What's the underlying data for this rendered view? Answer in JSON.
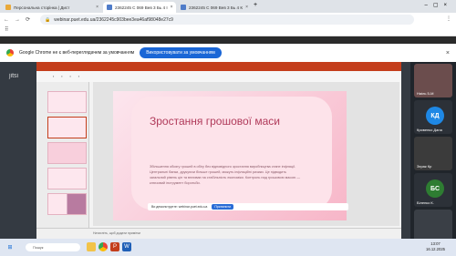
{
  "tabs": [
    {
      "label": "Персональна сторінка | Дист"
    },
    {
      "label": "2362245 С 069 Вев 3 Бь 4 І"
    },
    {
      "label": "2362245 С 069 Вев 3 Бь 4 К"
    }
  ],
  "address": {
    "url": "webinar.puet.edu.ua/2362245c903bee3ea46af98048e27c9"
  },
  "notice": {
    "text": "Google Chrome не є веб-переглядачем за умовчанням",
    "button": "Використовувати за умовчанням"
  },
  "jitsi": {
    "logo": "jitsi"
  },
  "slide": {
    "title": "Зростання грошової маси",
    "body": "Збільшення обсягу грошей в обігу без відповідного зростання виробництва стане інфляції. Центральні банки, друкуючи більше грошей, можуть інфляційні ризики. Це підводить загальний рівень цін та впливає на стабільність економіки. Контроль над грошовою масою — ключовий інструмент боротьби."
  },
  "status": {
    "text": "Натисніть, щоб додати примітки"
  },
  "share": {
    "text": "Ви демонструєте: webinar.puet.edu.ua",
    "stop": "Припинити"
  },
  "participants": [
    {
      "initials": "",
      "name": "Наіль 5-М",
      "color": "#7f5b5b"
    },
    {
      "initials": "КД",
      "name": "Кривенко Дана",
      "color": "#1e88e5"
    },
    {
      "initials": "",
      "name": "Зєрак Кр",
      "color": "#555"
    },
    {
      "initials": "БС",
      "name": "Біленко К.",
      "color": "#2e7d32"
    },
    {
      "initials": "",
      "name": "",
      "color": "#444"
    }
  ],
  "taskbar": {
    "search": "Пошук",
    "time": "13:07",
    "date": "16.12.2025"
  }
}
